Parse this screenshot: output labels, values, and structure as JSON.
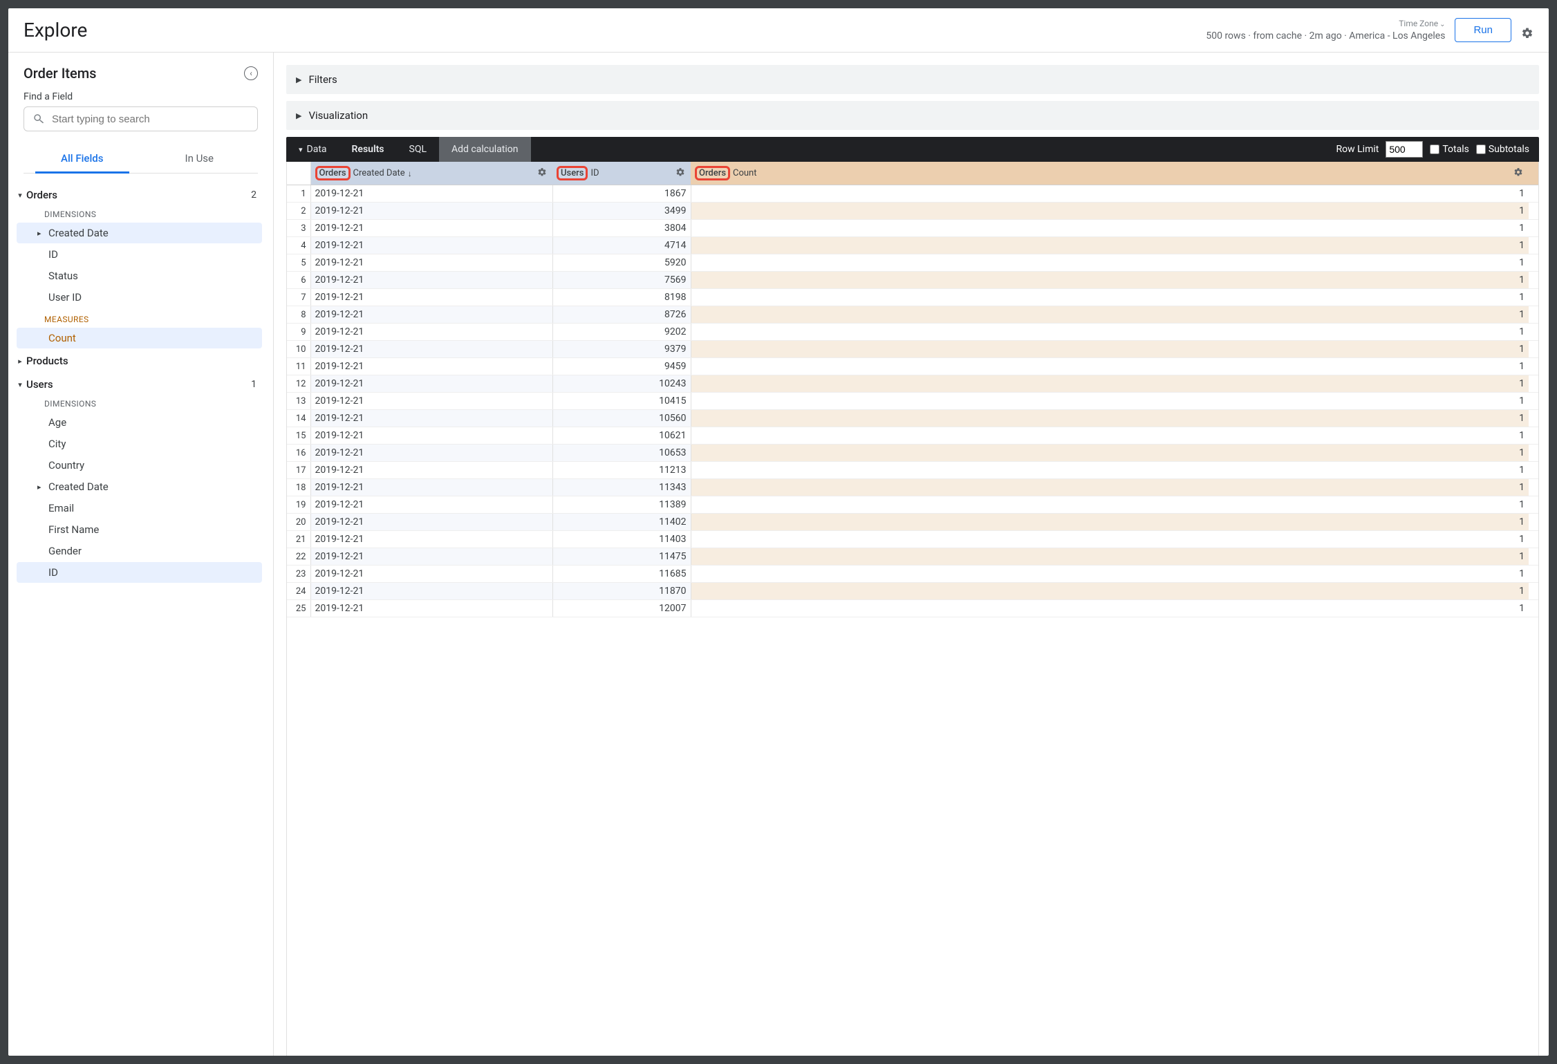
{
  "topbar": {
    "title": "Explore",
    "timezone_label": "Time Zone",
    "meta": "500 rows · from cache · 2m ago · America - Los Angeles",
    "run": "Run"
  },
  "sidebar": {
    "title": "Order Items",
    "find_label": "Find a Field",
    "search_placeholder": "Start typing to search",
    "tabs": {
      "all": "All Fields",
      "in_use": "In Use"
    },
    "views": [
      {
        "name": "Orders",
        "count": "2",
        "expanded": true,
        "dim_label": "DIMENSIONS",
        "dims": [
          {
            "label": "Created Date",
            "expandable": true,
            "selected": true
          },
          {
            "label": "ID"
          },
          {
            "label": "Status"
          },
          {
            "label": "User ID"
          }
        ],
        "meas_label": "MEASURES",
        "meas": [
          {
            "label": "Count",
            "selected": true
          }
        ]
      },
      {
        "name": "Products",
        "expanded": false
      },
      {
        "name": "Users",
        "count": "1",
        "expanded": true,
        "dim_label": "DIMENSIONS",
        "dims": [
          {
            "label": "Age"
          },
          {
            "label": "City"
          },
          {
            "label": "Country"
          },
          {
            "label": "Created Date",
            "expandable": true
          },
          {
            "label": "Email"
          },
          {
            "label": "First Name"
          },
          {
            "label": "Gender"
          },
          {
            "label": "ID",
            "selected": true
          }
        ]
      }
    ]
  },
  "accordions": {
    "filters": "Filters",
    "viz": "Visualization"
  },
  "databar": {
    "data": "Data",
    "results": "Results",
    "sql": "SQL",
    "add_calc": "Add calculation",
    "row_limit_label": "Row Limit",
    "row_limit_value": "500",
    "totals": "Totals",
    "subtotals": "Subtotals"
  },
  "columns": [
    {
      "view": "Orders",
      "field": "Created Date",
      "sort": "↓",
      "type": "dim"
    },
    {
      "view": "Users",
      "field": "ID",
      "type": "dim"
    },
    {
      "view": "Orders",
      "field": "Count",
      "type": "meas"
    }
  ],
  "rows": [
    [
      "2019-12-21",
      "1867",
      "1"
    ],
    [
      "2019-12-21",
      "3499",
      "1"
    ],
    [
      "2019-12-21",
      "3804",
      "1"
    ],
    [
      "2019-12-21",
      "4714",
      "1"
    ],
    [
      "2019-12-21",
      "5920",
      "1"
    ],
    [
      "2019-12-21",
      "7569",
      "1"
    ],
    [
      "2019-12-21",
      "8198",
      "1"
    ],
    [
      "2019-12-21",
      "8726",
      "1"
    ],
    [
      "2019-12-21",
      "9202",
      "1"
    ],
    [
      "2019-12-21",
      "9379",
      "1"
    ],
    [
      "2019-12-21",
      "9459",
      "1"
    ],
    [
      "2019-12-21",
      "10243",
      "1"
    ],
    [
      "2019-12-21",
      "10415",
      "1"
    ],
    [
      "2019-12-21",
      "10560",
      "1"
    ],
    [
      "2019-12-21",
      "10621",
      "1"
    ],
    [
      "2019-12-21",
      "10653",
      "1"
    ],
    [
      "2019-12-21",
      "11213",
      "1"
    ],
    [
      "2019-12-21",
      "11343",
      "1"
    ],
    [
      "2019-12-21",
      "11389",
      "1"
    ],
    [
      "2019-12-21",
      "11402",
      "1"
    ],
    [
      "2019-12-21",
      "11403",
      "1"
    ],
    [
      "2019-12-21",
      "11475",
      "1"
    ],
    [
      "2019-12-21",
      "11685",
      "1"
    ],
    [
      "2019-12-21",
      "11870",
      "1"
    ],
    [
      "2019-12-21",
      "12007",
      "1"
    ]
  ]
}
